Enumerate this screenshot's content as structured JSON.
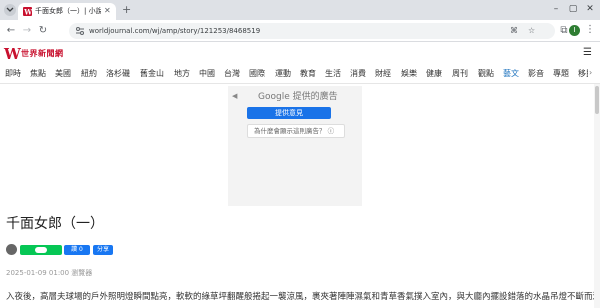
{
  "browser": {
    "tab_title": "千面女郎（一）| 小說世界 | 副",
    "url": "worldjournal.com/wj/amp/story/121253/8468519",
    "avatar_letter": "I"
  },
  "site": {
    "logo_mark": "W",
    "logo_text": "世界新聞網",
    "brand_color": "#c8102e",
    "categories": [
      "即時",
      "焦點",
      "美國",
      "紐約",
      "洛杉磯",
      "舊金山",
      "地方",
      "中國",
      "台灣",
      "國際",
      "運動",
      "教育",
      "生活",
      "消費",
      "財經",
      "娛樂",
      "健康",
      "周刊",
      "觀點",
      "藝文",
      "影音",
      "專題",
      "移民"
    ],
    "active_category": "藝文"
  },
  "ad": {
    "google_label": "Google 提供的廣告",
    "feedback_label": "提供意見",
    "why_label": "為什麼會顯示這則廣告？ ⓘ"
  },
  "article": {
    "title": "千面女郎（一）",
    "like_label": "讚 0",
    "share_label": "分享",
    "meta": "2025-01-09 01:00  瀏覽器",
    "body": "入夜後，高層夫球場的戶外照明燈瞬間點亮，軟軟的綠草坪翻醒般捲起一襲涼風，裹夾著陣陣濕氣和青草香氣撲入室內，與大廳內擺設錯落的水晶吊燈不斷而過，一樣"
  }
}
